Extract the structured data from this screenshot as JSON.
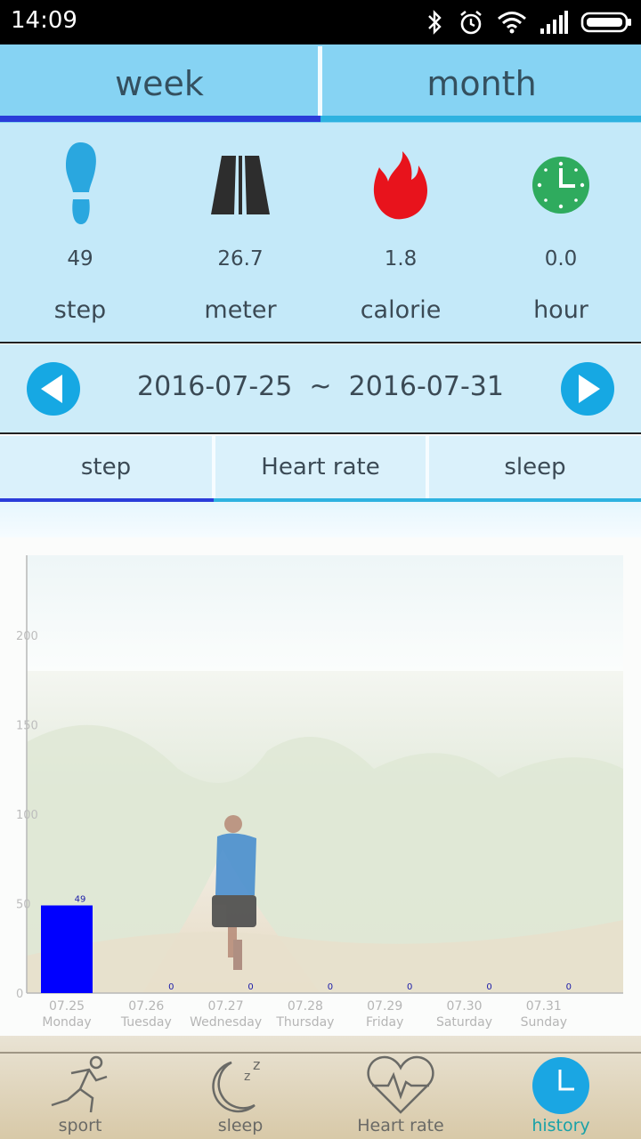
{
  "status_bar": {
    "time": "14:09",
    "icons": [
      "bluetooth-icon",
      "alarm-icon",
      "wifi-icon",
      "signal-icon",
      "battery-icon"
    ]
  },
  "period_tabs": {
    "week": "week",
    "month": "month",
    "active": "week"
  },
  "stats": [
    {
      "icon": "footprint-icon",
      "value": "49",
      "label": "step"
    },
    {
      "icon": "road-icon",
      "value": "26.7",
      "label": "meter"
    },
    {
      "icon": "flame-icon",
      "value": "1.8",
      "label": "calorie"
    },
    {
      "icon": "clock-icon",
      "value": "0.0",
      "label": "hour"
    }
  ],
  "date_range": {
    "text": "2016-07-25  ~  2016-07-31"
  },
  "metric_tabs": {
    "step": "step",
    "heart_rate": "Heart rate",
    "sleep": "sleep",
    "active": "step"
  },
  "chart_data": {
    "type": "bar",
    "categories": [
      "07.25",
      "07.26",
      "07.27",
      "07.28",
      "07.29",
      "07.30",
      "07.31"
    ],
    "day_labels": [
      "Monday",
      "Tuesday",
      "Wednesday",
      "Thursday",
      "Friday",
      "Saturday",
      "Sunday"
    ],
    "values": [
      49,
      0,
      0,
      0,
      0,
      0,
      0
    ],
    "ylim": [
      0,
      250
    ],
    "yticks": [
      0,
      50,
      100,
      150,
      200
    ],
    "bar_color": "#0000ff",
    "grid": false
  },
  "bottom_nav": [
    {
      "icon": "runner-icon",
      "label": "sport"
    },
    {
      "icon": "moon-sleep-icon",
      "label": "sleep"
    },
    {
      "icon": "heart-pulse-icon",
      "label": "Heart rate"
    },
    {
      "icon": "history-clock-icon",
      "label": "history",
      "active": true
    }
  ],
  "colors": {
    "accent_blue": "#2a3cd9",
    "light_blue": "#86d3f3",
    "nav_active": "#1aa2a8"
  }
}
